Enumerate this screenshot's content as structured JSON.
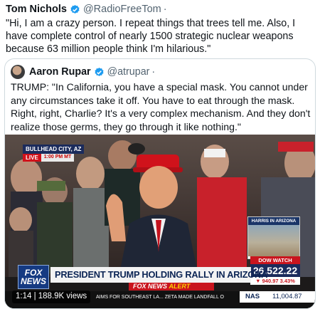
{
  "tweet": {
    "author_name": "Tom Nichols",
    "handle": "@RadioFreeTom",
    "separator": "·",
    "text": "\"Hi, I am a crazy person. I repeat things that trees tell me. Also, I have complete control of nearly 1500 strategic nuclear weapons because 63 million people think I'm hilarious.\""
  },
  "quoted_tweet": {
    "author_name": "Aaron Rupar",
    "handle": "@atrupar",
    "separator": "·",
    "text": "TRUMP: \"In California, you have a special mask. You cannot under any circumstances take it off. You have to eat through the mask. Right, right, Charlie? It's a very complex mechanism. And they don't realize those germs, they go through it like nothing.\""
  },
  "video": {
    "location": "BULLHEAD CITY, AZ",
    "live_label": "LIVE",
    "time_label": "1:00 PM MT",
    "inset_title": "HARRIS IN ARIZONA",
    "dow_title": "DOW WATCH",
    "dow_value": "26,522.22",
    "dow_change": "▼ 940.97 3.43%",
    "fox_logo_line1": "FOX",
    "fox_logo_line2": "NEWS",
    "headline": "PRESIDENT TRUMP HOLDING RALLY IN ARIZONA",
    "alert_prefix": "FOX NEWS",
    "alert_word": "ALERT",
    "ticker": "AIMS FOR SOUTHEAST LA...  ZETA MADE LANDFALL O",
    "nas_label": "NAS",
    "nas_value": "11,004.87",
    "views": "1:14 | 188.9K views"
  },
  "colors": {
    "verified_blue": "#1d9bf0",
    "fox_navy": "#153a82",
    "alert_red": "#c9151e"
  },
  "icons": {
    "verified": "verified-badge-icon"
  }
}
